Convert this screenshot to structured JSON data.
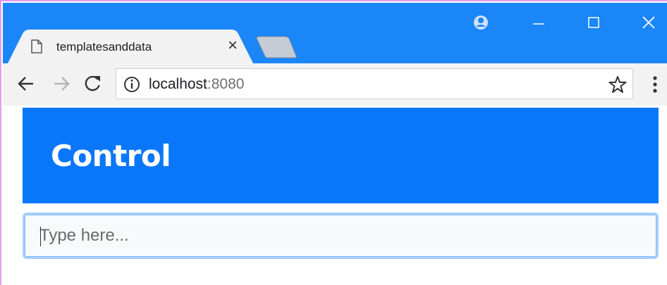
{
  "browser": {
    "tab": {
      "title": "templatesanddata",
      "page_icon": "document-icon",
      "close_glyph": "×"
    },
    "new_tab_icon": "new-tab-icon",
    "window_controls": [
      "profile-icon",
      "minimize-icon",
      "maximize-icon",
      "close-icon"
    ],
    "toolbar": {
      "back_icon": "arrow-left-icon",
      "forward_icon": "arrow-right-icon",
      "reload_icon": "reload-icon",
      "info_icon": "info-icon",
      "url_host": "localhost",
      "url_port": ":8080",
      "bookmark_icon": "star-icon",
      "menu_icon": "more-vert-icon"
    },
    "colors": {
      "titlebar": "#1a86f8",
      "toolbar": "#f2f2f2"
    }
  },
  "page": {
    "header": {
      "title": "Control",
      "background": "#0a77fa"
    },
    "input": {
      "placeholder": "Type here...",
      "value": ""
    }
  }
}
